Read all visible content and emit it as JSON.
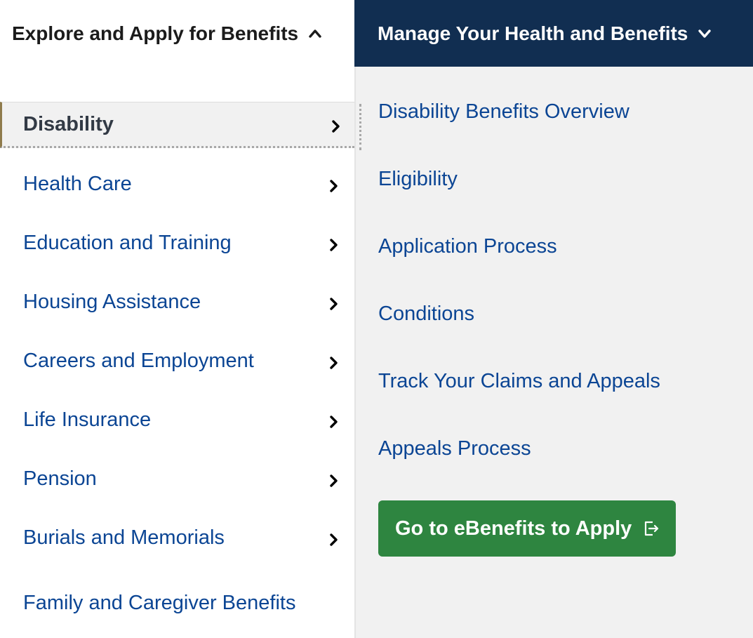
{
  "topnav": {
    "explore_label": "Explore and Apply for Benefits",
    "manage_label": "Manage Your Health and Benefits",
    "explore_bg": "#ffffff",
    "manage_bg": "#112e51"
  },
  "menu": {
    "items": [
      {
        "label": "Disability",
        "active": true,
        "has_arrow": true
      },
      {
        "label": "Health Care",
        "active": false,
        "has_arrow": true
      },
      {
        "label": "Education and Training",
        "active": false,
        "has_arrow": true
      },
      {
        "label": "Housing Assistance",
        "active": false,
        "has_arrow": true
      },
      {
        "label": "Careers and Employment",
        "active": false,
        "has_arrow": true
      },
      {
        "label": "Life Insurance",
        "active": false,
        "has_arrow": true
      },
      {
        "label": "Pension",
        "active": false,
        "has_arrow": true
      },
      {
        "label": "Burials and Memorials",
        "active": false,
        "has_arrow": true
      },
      {
        "label": "Family and Caregiver Benefits",
        "active": false,
        "has_arrow": false
      }
    ]
  },
  "submenu": {
    "links": [
      "Disability Benefits Overview",
      "Eligibility",
      "Application Process",
      "Conditions",
      "Track Your Claims and Appeals",
      "Appeals Process"
    ],
    "cta_label": "Go to eBenefits to Apply",
    "cta_icon": "external-link-icon",
    "cta_color": "#2e8540"
  },
  "colors": {
    "link": "#0b4594",
    "active_text": "#323a45",
    "panel_bg": "#f1f1f1"
  }
}
